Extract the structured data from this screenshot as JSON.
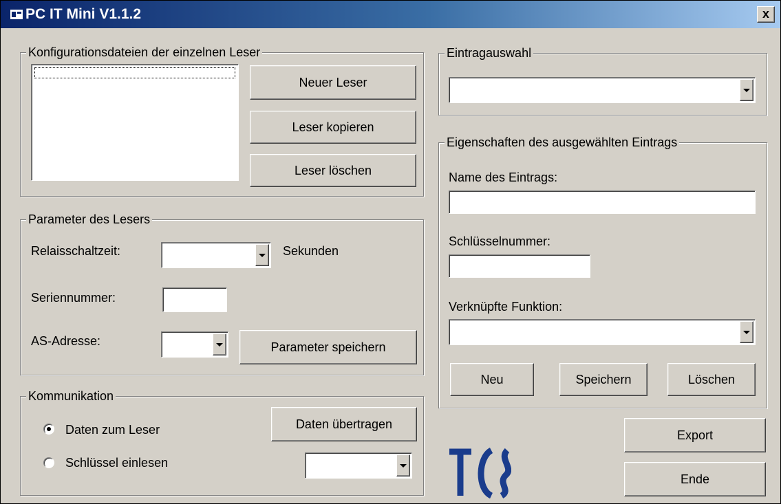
{
  "window": {
    "title": "PC IT Mini V1.1.2",
    "close_label": "x"
  },
  "konfig": {
    "legend": "Konfigurationsdateien der einzelnen Leser",
    "buttons": {
      "new": "Neuer Leser",
      "copy": "Leser kopieren",
      "delete": "Leser löschen"
    }
  },
  "parameter": {
    "legend": "Parameter des Lesers",
    "relay_label": "Relaisschaltzeit:",
    "relay_unit": "Sekunden",
    "serial_label": "Seriennummer:",
    "serial_value": "",
    "as_label": "AS-Adresse:",
    "save_button": "Parameter speichern"
  },
  "kommunikation": {
    "legend": "Kommunikation",
    "radio_send": "Daten zum Leser",
    "radio_send_checked": true,
    "radio_read": "Schlüssel einlesen",
    "transfer_button": "Daten übertragen"
  },
  "eintragauswahl": {
    "legend": "Eintragauswahl"
  },
  "eigenschaften": {
    "legend": "Eigenschaften des ausgewählten Eintrags",
    "name_label": "Name des Eintrags:",
    "name_value": "",
    "key_label": "Schlüsselnummer:",
    "key_value": "",
    "function_label": "Verknüpfte Funktion:",
    "buttons": {
      "new": "Neu",
      "save": "Speichern",
      "delete": "Löschen"
    }
  },
  "footer": {
    "export": "Export",
    "end": "Ende"
  },
  "logo": {
    "text": "TCS",
    "color": "#1a3c8c"
  }
}
